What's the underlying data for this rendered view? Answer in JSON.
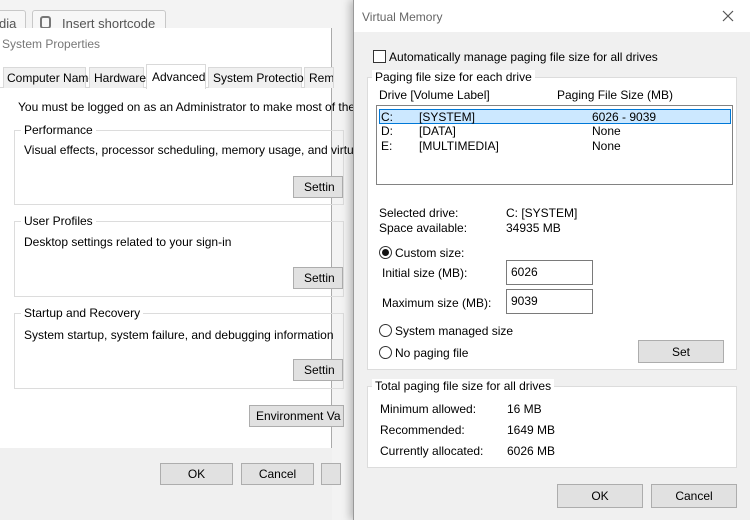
{
  "background": {
    "browser_tab_partial": "dia",
    "browser_button_partial": "Insert shortcode"
  },
  "system_properties": {
    "title": "System Properties",
    "tabs": [
      "Computer Name",
      "Hardware",
      "Advanced",
      "System Protection",
      "Rem"
    ],
    "active_tab": "Advanced",
    "admin_note": "You must be logged on as an Administrator to make most of these c",
    "performance": {
      "title": "Performance",
      "description": "Visual effects, processor scheduling, memory usage, and virtual m",
      "settings_label": "Settin"
    },
    "user_profiles": {
      "title": "User Profiles",
      "description": "Desktop settings related to your sign-in",
      "settings_label": "Settin"
    },
    "startup_recovery": {
      "title": "Startup and Recovery",
      "description": "System startup, system failure, and debugging information",
      "settings_label": "Settin"
    },
    "env_vars_label": "Environment Va",
    "ok_label": "OK",
    "cancel_label": "Cancel"
  },
  "virtual_memory": {
    "title": "Virtual Memory",
    "auto_manage_label": "Automatically manage paging file size for all drives",
    "auto_manage_checked": false,
    "paging_group_title": "Paging file size for each drive",
    "col_drive": "Drive  [Volume Label]",
    "col_size": "Paging File Size (MB)",
    "drives": [
      {
        "letter": "C:",
        "label": "[SYSTEM]",
        "size": "6026 - 9039",
        "selected": true
      },
      {
        "letter": "D:",
        "label": "[DATA]",
        "size": "None",
        "selected": false
      },
      {
        "letter": "E:",
        "label": "[MULTIMEDIA]",
        "size": "None",
        "selected": false
      }
    ],
    "selected_drive_label": "Selected drive:",
    "selected_drive_value": "C:  [SYSTEM]",
    "space_available_label": "Space available:",
    "space_available_value": "34935 MB",
    "custom_size_label": "Custom size:",
    "initial_size_label": "Initial size (MB):",
    "initial_size_value": "6026",
    "max_size_label": "Maximum size (MB):",
    "max_size_value": "9039",
    "system_managed_label": "System managed size",
    "no_paging_label": "No paging file",
    "selected_option": "custom",
    "set_label": "Set",
    "total_group_title": "Total paging file size for all drives",
    "minimum_allowed_label": "Minimum allowed:",
    "minimum_allowed_value": "16 MB",
    "recommended_label": "Recommended:",
    "recommended_value": "1649 MB",
    "currently_allocated_label": "Currently allocated:",
    "currently_allocated_value": "6026 MB",
    "ok_label": "OK",
    "cancel_label": "Cancel"
  },
  "colors": {
    "selection": "#cce8ff",
    "selection_border": "#0078d7",
    "button": "#e1e1e1"
  }
}
